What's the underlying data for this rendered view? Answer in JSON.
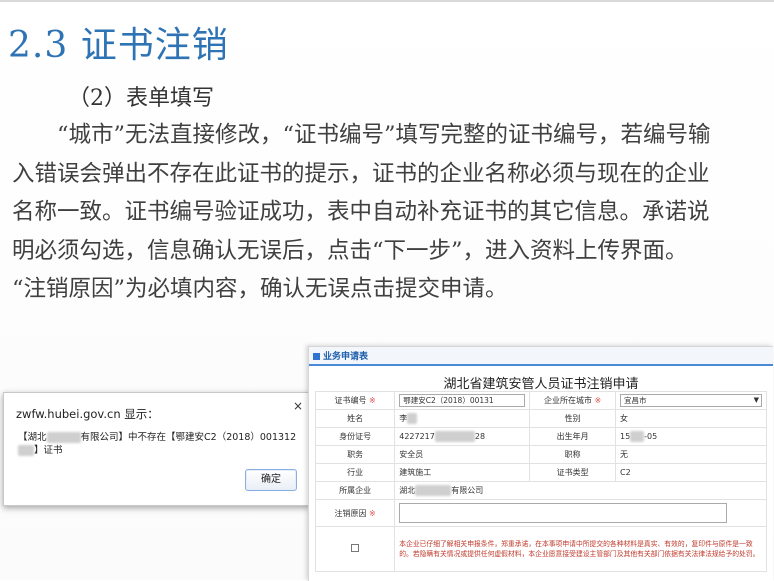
{
  "slide": {
    "title": "2.3 证书注销",
    "subheading": "（2）表单填写",
    "paragraph": "“城市”无法直接修改，“证书编号”填写完整的证书编号，若编号输入错误会弹出不存在此证书的提示，证书的企业名称必须与现在的企业名称一致。证书编号验证成功，表中自动补充证书的其它信息。承诺说明必须勾选，信息确认无误后，点击“下一步”，进入资料上传界面。 “注销原因”为必填内容，确认无误点击提交申请。"
  },
  "alert": {
    "title": "zwfw.hubei.gov.cn 显示：",
    "close_glyph": "×",
    "msg_prefix": "【湖北",
    "msg_mid": "有限公司】中不存在【鄂建安C2（2018）001312",
    "msg_suffix": "】证书",
    "ok_label": "确定"
  },
  "form": {
    "tab_label": "业务申请表",
    "title": "湖北省建筑安管人员证书注销申请",
    "required_mark": "※",
    "labels": {
      "cert_no": "证书编号",
      "city": "企业所在城市",
      "name": "姓名",
      "gender": "性别",
      "id_no": "身份证号",
      "birth": "出生年月",
      "job": "职务",
      "title": "职称",
      "industry": "行业",
      "cert_type": "证书类型",
      "company": "所属企业",
      "reason": "注销原因"
    },
    "values": {
      "cert_no": "鄂建安C2（2018）00131",
      "city": "宜昌市",
      "name": "李",
      "gender": "女",
      "id_no_prefix": "4227217",
      "id_no_suffix": "28",
      "birth_prefix": "15",
      "birth_suffix": "-05",
      "job": "安全员",
      "title": "无",
      "industry": "建筑施工",
      "cert_type": "C2",
      "company_prefix": "湖北",
      "company_suffix": "有限公司"
    },
    "dropdown_arrow": "▼",
    "promise": "本企业已仔细了解相关申报条件，郑重承诺，在本事项申请中所提交的各种材料是真实、有效的，复印件与原件是一致的。若隐瞒有关情况或提供任何虚假材料，本企业愿意接受建设主管部门及其他有关部门依据有关法律法规给予的处罚。"
  }
}
